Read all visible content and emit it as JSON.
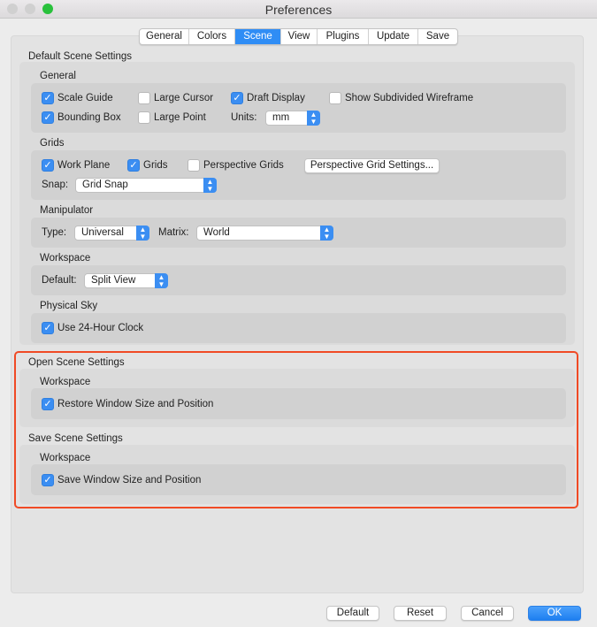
{
  "window": {
    "title": "Preferences"
  },
  "tabs": [
    {
      "label": "General"
    },
    {
      "label": "Colors"
    },
    {
      "label": "Scene",
      "selected": true
    },
    {
      "label": "View"
    },
    {
      "label": "Plugins"
    },
    {
      "label": "Update"
    },
    {
      "label": "Save"
    }
  ],
  "default_scene": {
    "title": "Default Scene Settings",
    "general": {
      "title": "General",
      "scale_guide": "Scale Guide",
      "large_cursor": "Large Cursor",
      "draft_display": "Draft Display",
      "show_subdivided": "Show Subdivided Wireframe",
      "bounding_box": "Bounding Box",
      "large_point": "Large Point",
      "units_label": "Units:",
      "units_value": "mm"
    },
    "grids": {
      "title": "Grids",
      "work_plane": "Work Plane",
      "grids": "Grids",
      "perspective_grids": "Perspective Grids",
      "perspective_button": "Perspective Grid Settings...",
      "snap_label": "Snap:",
      "snap_value": "Grid Snap"
    },
    "manipulator": {
      "title": "Manipulator",
      "type_label": "Type:",
      "type_value": "Universal",
      "matrix_label": "Matrix:",
      "matrix_value": "World"
    },
    "workspace": {
      "title": "Workspace",
      "default_label": "Default:",
      "default_value": "Split View"
    },
    "physical_sky": {
      "title": "Physical Sky",
      "clock": "Use 24-Hour Clock"
    }
  },
  "open_scene": {
    "title": "Open Scene Settings",
    "workspace_title": "Workspace",
    "restore": "Restore Window Size and Position"
  },
  "save_scene": {
    "title": "Save Scene Settings",
    "workspace_title": "Workspace",
    "save": "Save Window Size and Position"
  },
  "buttons": {
    "default": "Default",
    "reset": "Reset",
    "cancel": "Cancel",
    "ok": "OK"
  },
  "colors": {
    "accent": "#2f8df5",
    "highlight": "#f04a25"
  }
}
